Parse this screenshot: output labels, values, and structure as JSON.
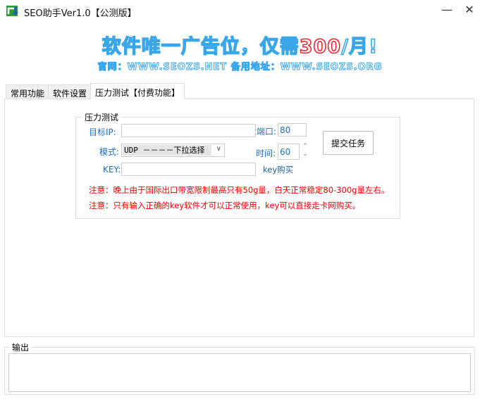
{
  "window": {
    "title": "SEO助手Ver1.0【公测版】",
    "minimize": "—",
    "close": "✕"
  },
  "banner": {
    "headline_main": "软件唯一广告位，仅需",
    "headline_price": "300",
    "headline_suffix": "/月!",
    "subline": "官网：WWW.SEOZS.NET 备用地址：WWW.SEOZS.ORG"
  },
  "tabs": [
    {
      "label": "常用功能"
    },
    {
      "label": "软件设置"
    },
    {
      "label": "压力测试【付费功能】",
      "active": true
    }
  ],
  "stress": {
    "group_title": "压力测试",
    "target_ip_label": "目标IP:",
    "target_ip_value": "",
    "port_label": "端口:",
    "port_value": "80",
    "mode_label": "模式:",
    "mode_value": "UDP －－－－下拉选择",
    "time_label": "时间:",
    "time_value": "60",
    "key_label": "KEY:",
    "key_value": "",
    "key_buy": "key购买",
    "submit": "提交任务",
    "note1": "注意：晚上由于国际出口带宽限制最高只有50g量，白天正常稳定80-300g量左右。",
    "note2": "注意：只有输入正确的key软件才可以正常使用，key可以直接走卡网购买。"
  },
  "output": {
    "title": "输出",
    "value": ""
  }
}
